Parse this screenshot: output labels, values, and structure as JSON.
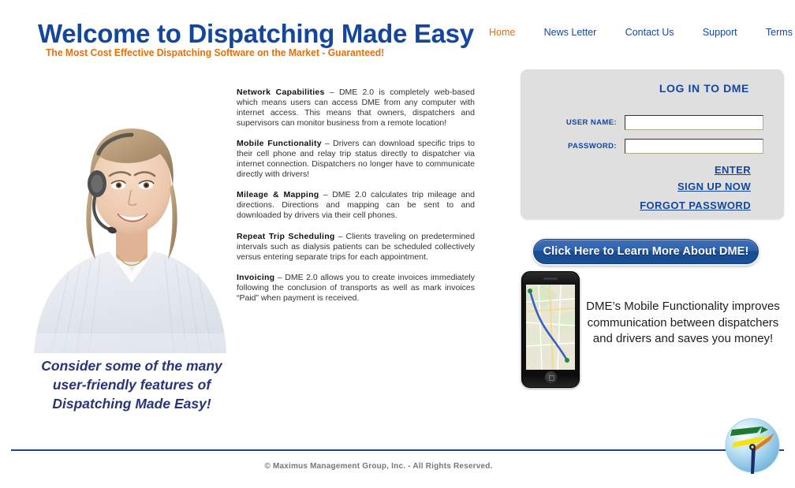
{
  "header": {
    "title": "Welcome to Dispatching Made Easy",
    "tagline": "The Most Cost Effective Dispatching Software on the Market - Guaranteed!",
    "title_color": "#14469b",
    "tagline_color": "#e2700d"
  },
  "nav": {
    "items": [
      {
        "label": "Home",
        "active": true
      },
      {
        "label": "News Letter",
        "active": false
      },
      {
        "label": "Contact Us",
        "active": false
      },
      {
        "label": "Support",
        "active": false
      },
      {
        "label": "Terms",
        "active": false
      }
    ],
    "active_color": "#e2700d",
    "link_color": "#14469b"
  },
  "photo": {
    "alt": "smiling-female-dispatcher-with-headset",
    "caption": "Consider some of the many user-friendly features of Dispatching Made Easy!",
    "caption_color": "#29347a"
  },
  "features": [
    {
      "title": "Network Capabilities",
      "body": " – DME 2.0 is completely web-based which means users can access DME from any computer with internet access.  This means that owners, dispatchers and supervisors can monitor business from a remote location!"
    },
    {
      "title": "Mobile Functionality",
      "body": " – Drivers can download specific trips to their cell phone and relay trip status directly to dispatcher via internet connection.  Dispatchers no longer have to communicate directly with drivers!"
    },
    {
      "title": "Mileage & Mapping",
      "body": " – DME 2.0 calculates trip mileage and directions.  Directions and mapping can be sent to and downloaded by drivers via their cell phones."
    },
    {
      "title": "Repeat Trip Scheduling",
      "body": " – Clients traveling on predetermined intervals such as dialysis patients can be scheduled collectively versus entering separate trips for each appointment."
    },
    {
      "title": "Invoicing",
      "body": " – DME 2.0 allows you to create invoices immediately following the conclusion of transports as well as mark invoices “Paid” when payment is received."
    }
  ],
  "login": {
    "heading": "LOG IN TO DME",
    "username_label": "USER NAME:",
    "username_value": "",
    "username_placeholder": "",
    "password_label": "PASSWORD:",
    "password_value": "",
    "password_placeholder": "",
    "enter_label": "ENTER",
    "signup_label": "SIGN UP NOW",
    "forgot_label": "FORGOT PASSWORD",
    "panel_color": "#dfdfdf",
    "text_color": "#14469b"
  },
  "cta": {
    "label": "Click Here to Learn More About DME!",
    "color": "#1a4f97"
  },
  "mobile_promo": {
    "text": "DME’s Mobile Functionality improves communication between dispatchers and drivers and saves you money!",
    "phone_icon": "smartphone-with-map-icon"
  },
  "footer": {
    "copyright": "© Maximus Management Group, Inc. - All Rights Reserved.",
    "divider_color": "#14469b",
    "logo_icon": "clock-sphere-logo"
  }
}
